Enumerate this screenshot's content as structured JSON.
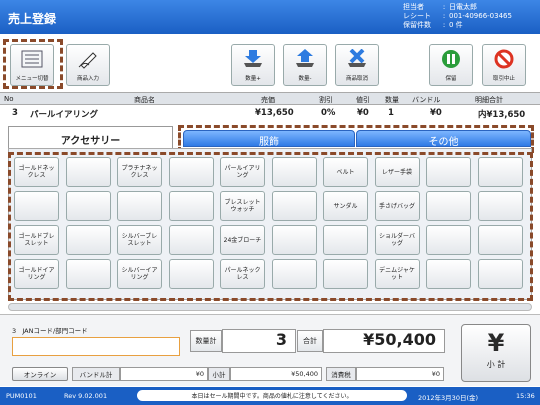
{
  "header": {
    "title": "売上登録",
    "info": [
      {
        "key": "担当者",
        "value": "日電太郎"
      },
      {
        "key": "レシート",
        "value": "001-40966-03465"
      },
      {
        "key": "保留件数",
        "value": "0 件"
      }
    ]
  },
  "toolbar": {
    "menu": "メニュー切替",
    "product_input": "商品入力",
    "qty_plus": "数量+",
    "qty_minus": "数量-",
    "product_cancel": "商品取消",
    "hold": "保留",
    "cancel_transaction": "取引中止"
  },
  "table": {
    "headers": [
      "No",
      "商品名",
      "売価",
      "割引",
      "値引",
      "数量",
      "バンドル",
      "明細合計"
    ],
    "row": [
      "3",
      "パールイアリング",
      "¥13,650",
      "0%",
      "¥0",
      "1",
      "¥0",
      "内¥13,650"
    ]
  },
  "tabs": [
    "アクセサリー",
    "服飾",
    "その他"
  ],
  "grid_buttons": [
    [
      "ゴールドネックレス",
      "",
      "プラチナネックレス",
      "",
      "パールイアリング",
      "",
      "ベルト",
      "レザー手袋",
      "",
      ""
    ],
    [
      "",
      "",
      "",
      "",
      "ブレスレットウォッチ",
      "",
      "サンダル",
      "手さげバッグ",
      "",
      ""
    ],
    [
      "ゴールドブレスレット",
      "",
      "シルバーブレスレット",
      "",
      "24金ブローチ",
      "",
      "",
      "ショルダーバッグ",
      "",
      ""
    ],
    [
      "ゴールドイアリング",
      "",
      "シルバーイアリング",
      "",
      "パールネックレス",
      "",
      "",
      "デニムジャケット",
      "",
      ""
    ]
  ],
  "entry": {
    "jan_label": "JANコード/部門コード",
    "line_no": "3",
    "jan_value": "",
    "qty_label": "数量計",
    "qty_value": "3",
    "total_label": "合計",
    "total_value": "¥50,400",
    "subtotal_icon": "¥",
    "subtotal_label": "小 計"
  },
  "status": {
    "online": "オンライン",
    "bundle_label": "バンドル計",
    "bundle_value": "¥0",
    "subtotal_label": "小計",
    "subtotal_value": "¥50,400",
    "tax_label": "消費税",
    "tax_value": "¥0",
    "small_zero": "¥0"
  },
  "footer": {
    "code": "PUM0101",
    "version": "Rev 9.02.001",
    "notice": "本日はセール期間中です。商品の値札に注意してください。",
    "date": "2012年3月30日(金)",
    "time": "15:36"
  },
  "colors": {
    "brand": "#1a5fc4",
    "annotation": "#8a4a2a",
    "tab_blue": "#2f7ae5"
  }
}
